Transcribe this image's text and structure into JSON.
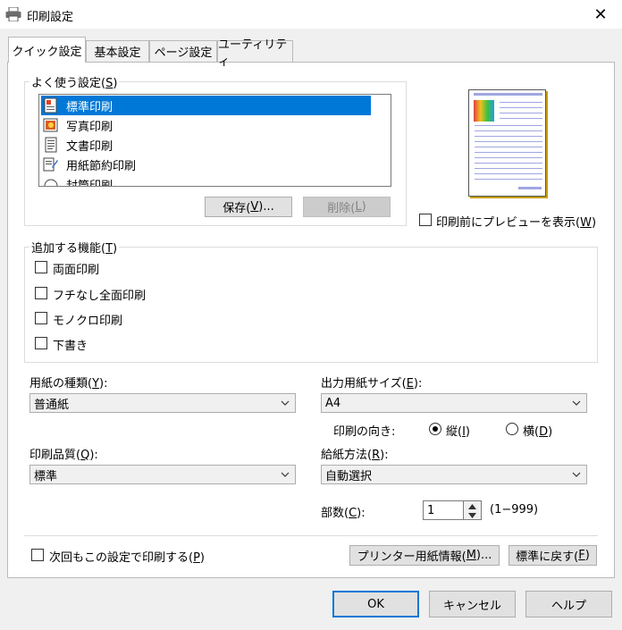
{
  "window": {
    "title": "印刷設定",
    "close_glyph": "✕"
  },
  "tabs": [
    {
      "label": "クイック設定",
      "active": true
    },
    {
      "label": "基本設定",
      "active": false
    },
    {
      "label": "ページ設定",
      "active": false
    },
    {
      "label": "ユーティリティ",
      "active": false
    }
  ],
  "favorites": {
    "group_label_pre": "よく使う設定(",
    "group_label_key": "S",
    "group_label_post": ")",
    "items": [
      {
        "label": "標準印刷",
        "icon": "standard-print-icon",
        "selected": true
      },
      {
        "label": "写真印刷",
        "icon": "photo-print-icon",
        "selected": false
      },
      {
        "label": "文書印刷",
        "icon": "document-print-icon",
        "selected": false
      },
      {
        "label": "用紙節約印刷",
        "icon": "paper-saving-icon",
        "selected": false
      },
      {
        "label": "封筒印刷",
        "icon": "envelope-print-icon",
        "selected": false
      }
    ],
    "save_pre": "保存(",
    "save_key": "V",
    "save_post": ")...",
    "delete_pre": "削除(",
    "delete_key": "L",
    "delete_post": ")"
  },
  "preview": {
    "checkbox_pre": "印刷前にプレビューを表示(",
    "checkbox_key": "W",
    "checkbox_post": ")",
    "checked": false
  },
  "features": {
    "group_pre": "追加する機能(",
    "group_key": "T",
    "group_post": ")",
    "items": [
      {
        "label": "両面印刷",
        "checked": false
      },
      {
        "label": "フチなし全面印刷",
        "checked": false
      },
      {
        "label": "モノクロ印刷",
        "checked": false
      },
      {
        "label": "下書き",
        "checked": false
      }
    ]
  },
  "media_type": {
    "label_pre": "用紙の種類(",
    "label_key": "Y",
    "label_post": "):",
    "value": "普通紙"
  },
  "output_size": {
    "label_pre": "出力用紙サイズ(",
    "label_key": "E",
    "label_post": "):",
    "value": "A4"
  },
  "orientation": {
    "label": "印刷の向き:",
    "portrait_pre": "縦(",
    "portrait_key": "I",
    "portrait_post": ")",
    "landscape_pre": "横(",
    "landscape_key": "D",
    "landscape_post": ")",
    "selected": "portrait"
  },
  "print_quality": {
    "label_pre": "印刷品質(",
    "label_key": "Q",
    "label_post": "):",
    "value": "標準"
  },
  "paper_source": {
    "label_pre": "給紙方法(",
    "label_key": "R",
    "label_post": "):",
    "value": "自動選択"
  },
  "copies": {
    "label_pre": "部数(",
    "label_key": "C",
    "label_post": "):",
    "value": "1",
    "range": "(1−999)"
  },
  "always_print": {
    "label_pre": "次回もこの設定で印刷する(",
    "label_key": "P",
    "label_post": ")",
    "checked": false
  },
  "printer_media_info": {
    "pre": "プリンター用紙情報(",
    "key": "M",
    "post": ")..."
  },
  "reset_defaults": {
    "pre": "標準に戻す(",
    "key": "F",
    "post": ")"
  },
  "footer": {
    "ok": "OK",
    "cancel": "キャンセル",
    "help": "ヘルプ"
  },
  "colors": {
    "accent": "#0078d7",
    "window_bg": "#f0f0f0",
    "panel_bg": "#ffffff"
  }
}
